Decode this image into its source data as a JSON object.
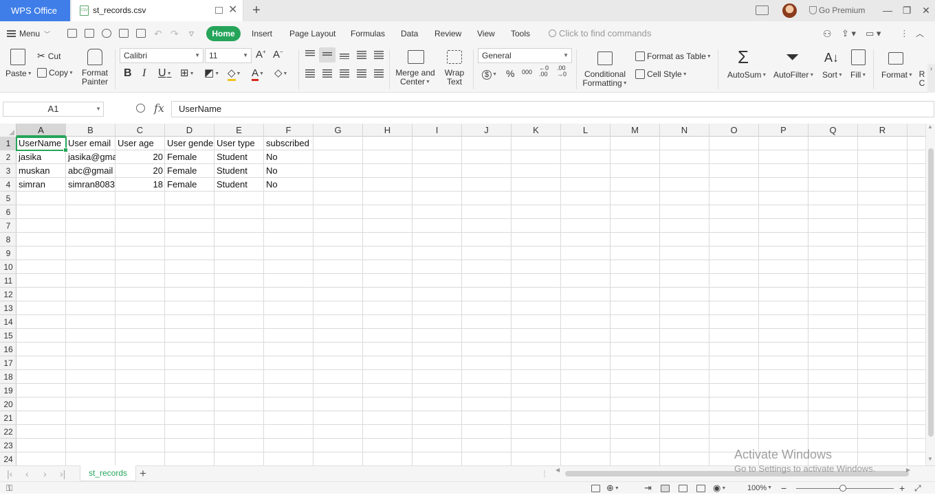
{
  "titlebar": {
    "app_name": "WPS Office",
    "doc_title": "st_records.csv",
    "csv_badge": "CSV",
    "premium": "Go Premium"
  },
  "menu": {
    "menu_label": "Menu",
    "tabs": [
      "Home",
      "Insert",
      "Page Layout",
      "Formulas",
      "Data",
      "Review",
      "View",
      "Tools"
    ],
    "search_placeholder": "Click to find commands"
  },
  "ribbon": {
    "paste": "Paste",
    "cut": "Cut",
    "copy": "Copy",
    "format_painter": [
      "Format",
      "Painter"
    ],
    "font_name": "Calibri",
    "font_size": "11",
    "bold": "B",
    "italic": "I",
    "underline": "U",
    "merge_center": [
      "Merge and",
      "Center"
    ],
    "wrap_text": [
      "Wrap",
      "Text"
    ],
    "number_format": "General",
    "currency": "$",
    "percent": "%",
    "thousands": "000",
    "inc_decimal": "←0 .00",
    "dec_decimal": ".00 →0",
    "conditional_formatting": [
      "Conditional",
      "Formatting"
    ],
    "format_as_table": "Format as Table",
    "cell_style": "Cell Style",
    "autosum": "AutoSum",
    "autofilter": "AutoFilter",
    "sort": "Sort",
    "fill": "Fill",
    "format": "Format",
    "partial_right": [
      "R",
      "C"
    ]
  },
  "formula_bar": {
    "name_box": "A1",
    "fx": "fx",
    "content": "UserName"
  },
  "grid": {
    "columns": [
      "A",
      "B",
      "C",
      "D",
      "E",
      "F",
      "G",
      "H",
      "I",
      "J",
      "K",
      "L",
      "M",
      "N",
      "O",
      "P",
      "Q",
      "R"
    ],
    "rows": [
      "1",
      "2",
      "3",
      "4",
      "5",
      "6",
      "7",
      "8",
      "9",
      "10",
      "11",
      "12",
      "13",
      "14",
      "15",
      "16",
      "17",
      "18",
      "19",
      "20",
      "21",
      "22",
      "23",
      "24"
    ],
    "header_row": [
      "UserName",
      "User email",
      "User age",
      "User gende",
      "User type",
      "subscribed"
    ],
    "data_rows": [
      [
        "jasika",
        "jasika@gma",
        "20",
        "Female",
        "Student",
        "No"
      ],
      [
        "muskan",
        "abc@gmail",
        "20",
        "Female",
        "Student",
        "No"
      ],
      [
        "simran",
        "simran8083",
        "18",
        "Female",
        "Student",
        "No"
      ]
    ]
  },
  "sheets": {
    "tabs": [
      "st_records"
    ]
  },
  "statusbar": {
    "zoom": "100%"
  },
  "watermark": {
    "line1": "Activate Windows",
    "line2": "Go to Settings to activate Windows."
  },
  "colors": {
    "accent_green": "#25a45a",
    "app_blue": "#3f7ee8"
  }
}
